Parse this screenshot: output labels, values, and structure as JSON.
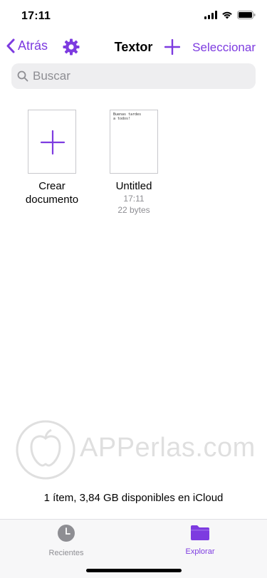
{
  "status_bar": {
    "time": "17:11"
  },
  "nav": {
    "back_label": "Atrás",
    "title": "Textor",
    "select_label": "Seleccionar"
  },
  "search": {
    "placeholder": "Buscar",
    "value": ""
  },
  "documents": [
    {
      "title_line1": "Crear",
      "title_line2": "documento"
    },
    {
      "title": "Untitled",
      "time": "17:11",
      "size": "22 bytes",
      "preview": "Buenas tardes\na todos!"
    }
  ],
  "watermark": {
    "text": "APPerlas.com"
  },
  "storage_text": "1 ítem, 3,84 GB disponibles en iCloud",
  "tabs": [
    {
      "label": "Recientes",
      "icon": "clock-icon",
      "active": false
    },
    {
      "label": "Explorar",
      "icon": "folder-icon",
      "active": true
    }
  ],
  "colors": {
    "accent": "#7d3be0",
    "inactive": "#8e8e93"
  }
}
